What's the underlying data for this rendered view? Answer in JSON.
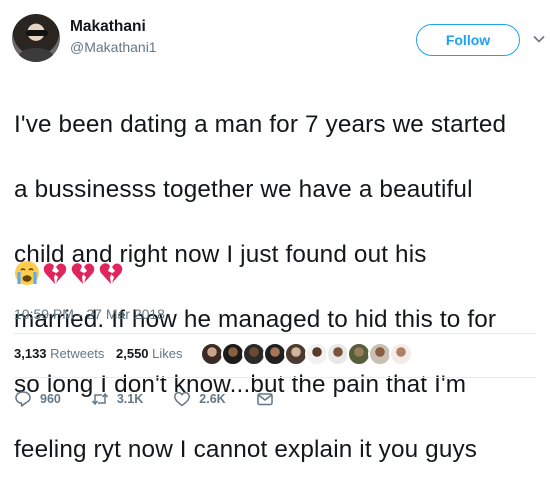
{
  "author": {
    "display_name": "Makathani",
    "handle": "@Makathani1"
  },
  "follow_label": "Follow",
  "tweet": {
    "text_lines": [
      "I've been dating a man for 7 years we started",
      "a bussinesss together we have a beautiful",
      "child and right now I just found out his",
      "married. If how he managed to hid this to for",
      "so long I don't know...but the pain that I'm",
      "feeling ryt now I cannot explain it you guys"
    ],
    "emojis": [
      "crying-face-icon",
      "broken-heart-icon",
      "broken-heart-icon",
      "broken-heart-icon"
    ],
    "timestamp": "10:59 PM - 27 Mar 2018"
  },
  "stats": {
    "retweets_count": "3,133",
    "retweets_label": "Retweets",
    "likes_count": "2,550",
    "likes_label": "Likes",
    "liker_avatars": 10
  },
  "actions": {
    "reply_count": "960",
    "retweet_count": "3.1K",
    "like_count": "2.6K"
  },
  "colors": {
    "accent": "#1da1f2",
    "muted": "#657786",
    "divider": "#e6ecf0",
    "broken_heart": "#e0245e"
  }
}
